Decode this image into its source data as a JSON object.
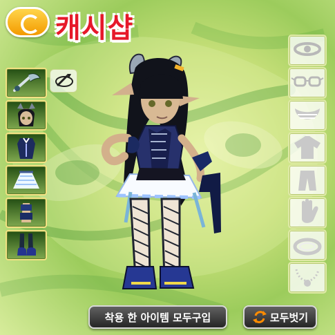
{
  "header": {
    "title": "캐시샵",
    "coin_icon": "cash-coin-icon"
  },
  "left_slots": [
    {
      "name": "weapon",
      "icon": "weapon-icon"
    },
    {
      "name": "face",
      "icon": "face-icon"
    },
    {
      "name": "upper",
      "icon": "upper-clothes-icon"
    },
    {
      "name": "lower",
      "icon": "skirt-icon"
    },
    {
      "name": "gloves",
      "icon": "gloves-icon"
    },
    {
      "name": "shoes",
      "icon": "shoes-icon"
    }
  ],
  "rotate_icon": "rotate-icon",
  "right_slots": [
    {
      "name": "head",
      "icon": "headband-icon"
    },
    {
      "name": "eyes",
      "icon": "glasses-icon"
    },
    {
      "name": "mouth",
      "icon": "mouth-icon"
    },
    {
      "name": "top",
      "icon": "shirt-icon"
    },
    {
      "name": "bottom",
      "icon": "pants-icon"
    },
    {
      "name": "hand",
      "icon": "glove-icon"
    },
    {
      "name": "ring",
      "icon": "ring-icon"
    },
    {
      "name": "necklace",
      "icon": "necklace-icon"
    }
  ],
  "buttons": {
    "buy_all": "착용 한 아이템 모두구입",
    "unequip_all": "모두벗기"
  },
  "colors": {
    "title": "#e6192a",
    "background": "#c8e07a",
    "slot": "#2e5a18"
  }
}
